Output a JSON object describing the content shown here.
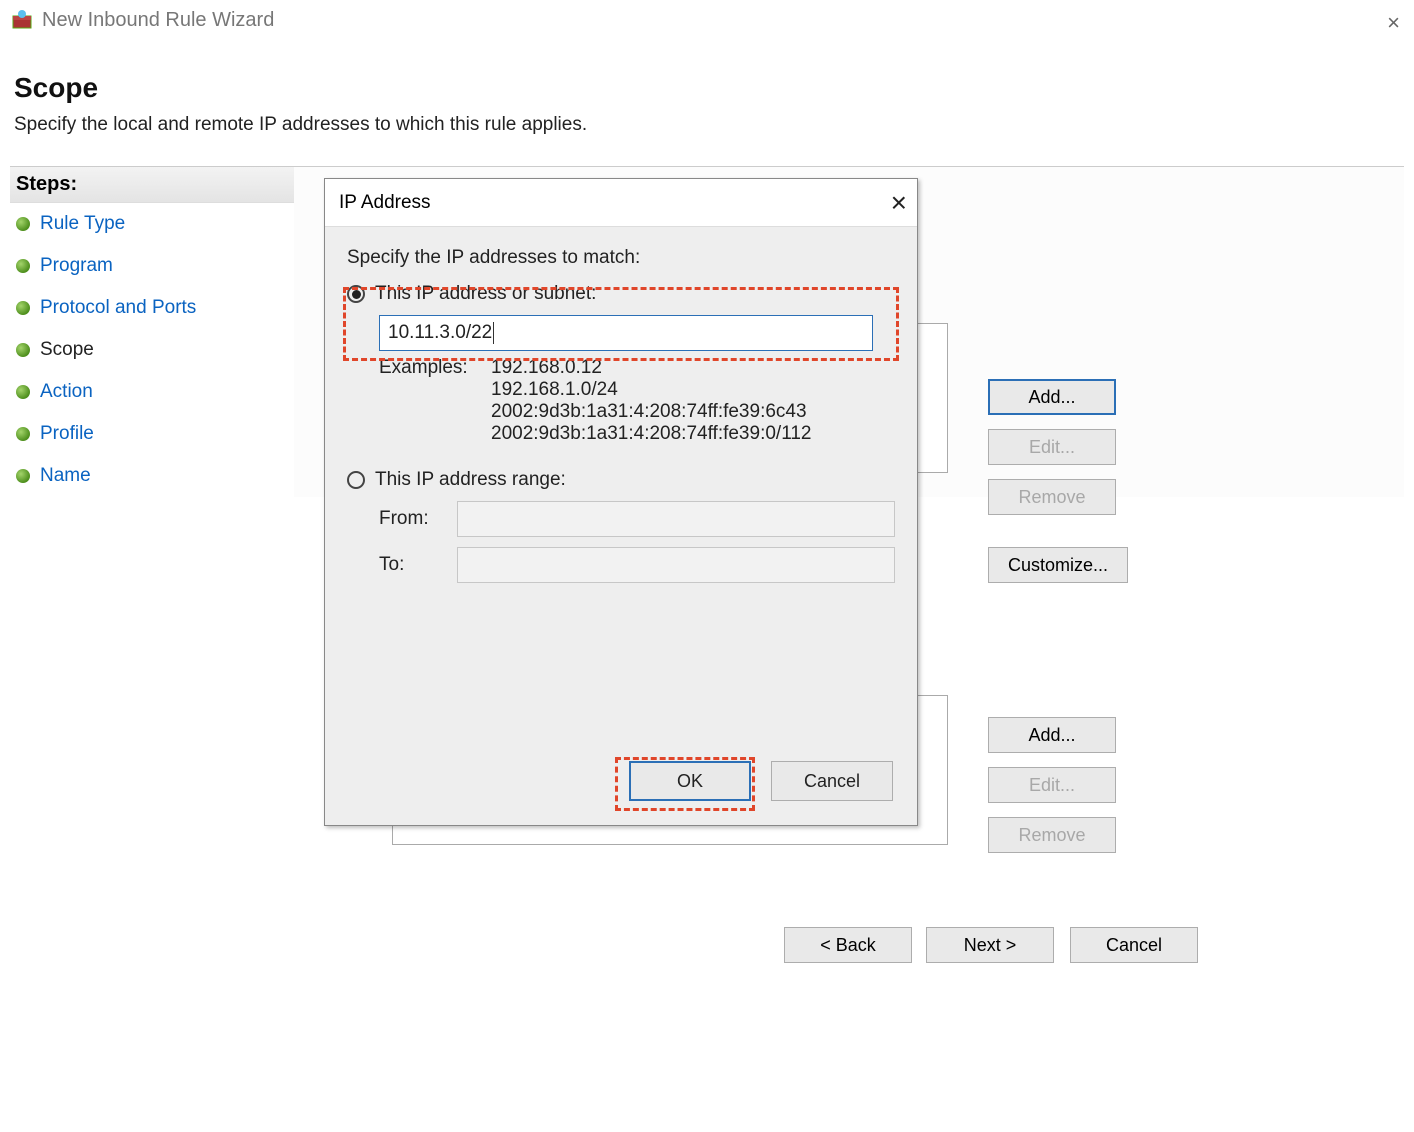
{
  "window": {
    "title": "New Inbound Rule Wizard",
    "page_title": "Scope",
    "subtitle": "Specify the local and remote IP addresses to which this rule applies."
  },
  "steps": {
    "header": "Steps:",
    "items": [
      {
        "label": "Rule Type",
        "selected": false
      },
      {
        "label": "Program",
        "selected": false
      },
      {
        "label": "Protocol and Ports",
        "selected": false
      },
      {
        "label": "Scope",
        "selected": true
      },
      {
        "label": "Action",
        "selected": false
      },
      {
        "label": "Profile",
        "selected": false
      },
      {
        "label": "Name",
        "selected": false
      }
    ]
  },
  "buttons": {
    "add": "Add...",
    "edit": "Edit...",
    "remove": "Remove",
    "customize": "Customize...",
    "back": "< Back",
    "next": "Next >",
    "cancel": "Cancel"
  },
  "dialog": {
    "title": "IP Address",
    "prompt": "Specify the IP addresses to match:",
    "option_subnet": "This IP address or subnet:",
    "ip_value": "10.11.3.0/22",
    "examples_label": "Examples:",
    "examples": [
      "192.168.0.12",
      "192.168.1.0/24",
      "2002:9d3b:1a31:4:208:74ff:fe39:6c43",
      "2002:9d3b:1a31:4:208:74ff:fe39:0/112"
    ],
    "option_range": "This IP address range:",
    "from": "From:",
    "to": "To:",
    "ok": "OK",
    "cancel": "Cancel"
  }
}
